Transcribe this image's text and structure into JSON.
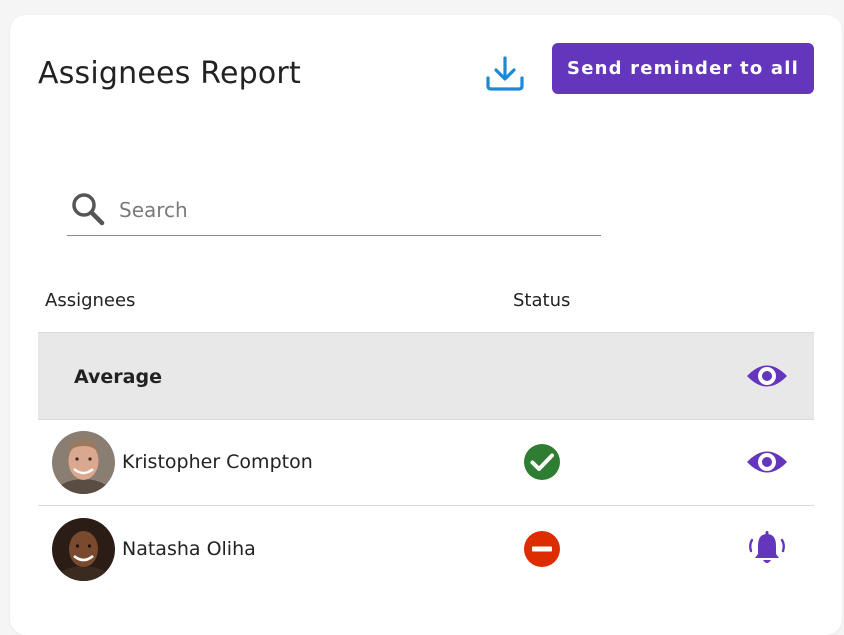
{
  "header": {
    "title": "Assignees Report",
    "download_icon": "download-icon",
    "send_reminder_label": "Send reminder to all"
  },
  "search": {
    "placeholder": "Search",
    "value": ""
  },
  "table": {
    "columns": [
      "Assignees",
      "Status"
    ],
    "average_row": {
      "label": "Average",
      "action_icon": "eye-icon"
    },
    "rows": [
      {
        "name": "Kristopher Compton",
        "status": "completed",
        "status_icon": "check-circle-icon",
        "action_icon": "eye-icon"
      },
      {
        "name": "Natasha Oliha",
        "status": "not-completed",
        "status_icon": "minus-circle-icon",
        "action_icon": "bell-icon"
      }
    ]
  },
  "colors": {
    "accent": "#6436bd",
    "download_blue": "#1a8ad8",
    "success": "#2e7d32",
    "danger": "#dd2c00",
    "average_bg": "#e8e8e8"
  }
}
